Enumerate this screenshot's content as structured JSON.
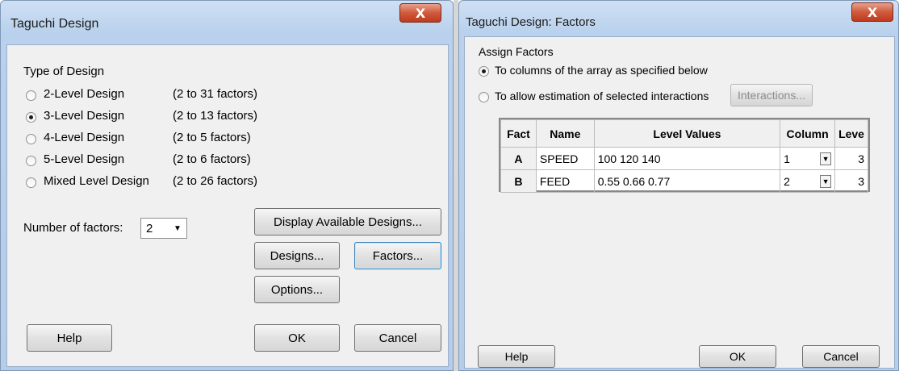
{
  "left_dialog": {
    "title": "Taguchi Design",
    "close_glyph": "X",
    "type_label": "Type of Design",
    "designs": [
      {
        "label": "2-Level Design",
        "range": "(2 to 31 factors)",
        "selected": false
      },
      {
        "label": "3-Level Design",
        "range": "(2 to 13 factors)",
        "selected": true
      },
      {
        "label": "4-Level Design",
        "range": "(2 to 5 factors)",
        "selected": false
      },
      {
        "label": "5-Level Design",
        "range": "(2 to 6 factors)",
        "selected": false
      },
      {
        "label": "Mixed Level Design",
        "range": "(2 to 26 factors)",
        "selected": false
      }
    ],
    "num_factors_label": "Number of factors:",
    "num_factors_value": "2",
    "buttons": {
      "display": "Display Available Designs...",
      "designs": "Designs...",
      "factors": "Factors...",
      "options": "Options...",
      "help": "Help",
      "ok": "OK",
      "cancel": "Cancel"
    }
  },
  "right_dialog": {
    "title": "Taguchi Design: Factors",
    "close_glyph": "X",
    "assign_label": "Assign Factors",
    "options": [
      {
        "label": "To columns of the array as specified below",
        "selected": true
      },
      {
        "label": "To allow estimation of selected interactions",
        "selected": false
      }
    ],
    "interactions_button": "Interactions...",
    "table": {
      "headers": [
        "Fact",
        "Name",
        "Level Values",
        "Column",
        "Leve"
      ],
      "rows": [
        {
          "fact": "A",
          "name": "SPEED",
          "levels": "100 120 140",
          "column": "1",
          "leve": "3"
        },
        {
          "fact": "B",
          "name": "FEED",
          "levels": "0.55 0.66 0.77",
          "column": "2",
          "leve": "3"
        }
      ]
    },
    "buttons": {
      "help": "Help",
      "ok": "OK",
      "cancel": "Cancel"
    }
  }
}
